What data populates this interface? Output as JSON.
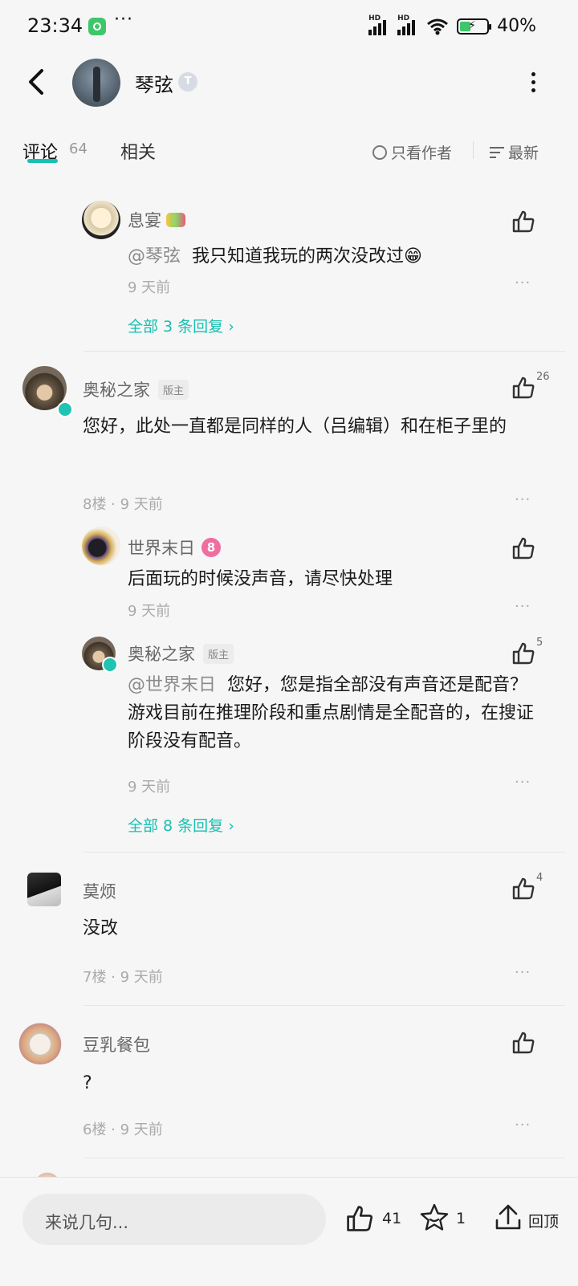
{
  "status": {
    "time": "23:34",
    "dots": "···",
    "battery_pct": "40%",
    "battery_level": 0.4,
    "hd": "HD"
  },
  "header": {
    "title": "琴弦",
    "badge": "T"
  },
  "tabs": {
    "comments_label": "评论",
    "comments_count": "64",
    "related_label": "相关"
  },
  "filters": {
    "author_only": "只看作者",
    "sort": "最新"
  },
  "comments": [
    {
      "name": "息宴",
      "mention": "@琴弦",
      "text": "我只知道我玩的两次没改过😁",
      "time": "9 天前",
      "replies_link": "全部 3 条回复 ›"
    },
    {
      "name": "奥秘之家",
      "badge": "版主",
      "likes": "26",
      "text": "您好，此处一直都是同样的人（吕编辑）和在柜子里的",
      "floor_time": "8楼 · 9 天前",
      "replies": [
        {
          "name": "世界末日",
          "level": "8",
          "text": "后面玩的时候没声音，请尽快处理",
          "time": "9 天前"
        },
        {
          "name": "奥秘之家",
          "badge": "版主",
          "likes": "5",
          "mention": "@世界末日",
          "text": "您好，您是指全部没有声音还是配音？游戏目前在推理阶段和重点剧情是全配音的，在搜证阶段没有配音。",
          "time": "9 天前"
        }
      ],
      "replies_link": "全部 8 条回复 ›"
    },
    {
      "name": "莫烦",
      "likes": "4",
      "text": "没改",
      "floor_time": "7楼 · 9 天前"
    },
    {
      "name": "豆乳餐包",
      "text": "?",
      "floor_time": "6楼 · 9 天前"
    }
  ],
  "more_dots": "···",
  "bottom": {
    "input_placeholder": "来说几句...",
    "like_count": "41",
    "fav_count": "1",
    "top_label": "回顶"
  },
  "colors": {
    "accent": "#17c0b0",
    "background": "#f6f6f6"
  }
}
